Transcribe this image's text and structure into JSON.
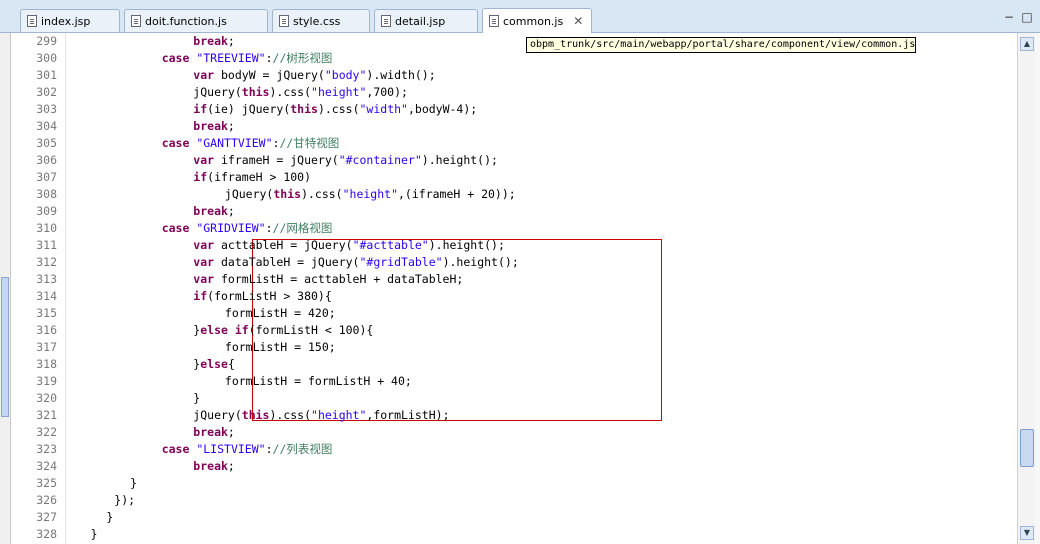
{
  "tabs": [
    {
      "label": "index.jsp",
      "active": false
    },
    {
      "label": "doit.function.js",
      "active": false
    },
    {
      "label": "style.css",
      "active": false
    },
    {
      "label": "detail.jsp",
      "active": false
    },
    {
      "label": "common.js",
      "active": true
    }
  ],
  "window_controls": {
    "minimize": "−",
    "maximize": "□"
  },
  "tooltip": "obpm_trunk/src/main/webapp/portal/share/component/view/common.js",
  "lines": [
    {
      "num": "299",
      "indent": 12,
      "tokens": [
        {
          "t": "kw",
          "v": "break"
        },
        {
          "t": "tx",
          "v": ";"
        }
      ]
    },
    {
      "num": "300",
      "indent": 8,
      "tokens": [
        {
          "t": "kw",
          "v": "case"
        },
        {
          "t": "tx",
          "v": " "
        },
        {
          "t": "str",
          "v": "\"TREEVIEW\""
        },
        {
          "t": "tx",
          "v": ":"
        },
        {
          "t": "cmt",
          "v": "//树形视图"
        }
      ]
    },
    {
      "num": "301",
      "indent": 12,
      "tokens": [
        {
          "t": "kw",
          "v": "var"
        },
        {
          "t": "tx",
          "v": " bodyW = jQuery("
        },
        {
          "t": "str",
          "v": "\"body\""
        },
        {
          "t": "tx",
          "v": ").width();"
        }
      ]
    },
    {
      "num": "302",
      "indent": 12,
      "tokens": [
        {
          "t": "tx",
          "v": "jQuery("
        },
        {
          "t": "kw",
          "v": "this"
        },
        {
          "t": "tx",
          "v": ").css("
        },
        {
          "t": "str",
          "v": "\"height\""
        },
        {
          "t": "tx",
          "v": ",700);"
        }
      ]
    },
    {
      "num": "303",
      "indent": 12,
      "tokens": [
        {
          "t": "kw",
          "v": "if"
        },
        {
          "t": "tx",
          "v": "(ie) jQuery("
        },
        {
          "t": "kw",
          "v": "this"
        },
        {
          "t": "tx",
          "v": ").css("
        },
        {
          "t": "str",
          "v": "\"width\""
        },
        {
          "t": "tx",
          "v": ",bodyW-4);"
        }
      ]
    },
    {
      "num": "304",
      "indent": 12,
      "tokens": [
        {
          "t": "kw",
          "v": "break"
        },
        {
          "t": "tx",
          "v": ";"
        }
      ]
    },
    {
      "num": "305",
      "indent": 8,
      "tokens": [
        {
          "t": "kw",
          "v": "case"
        },
        {
          "t": "tx",
          "v": " "
        },
        {
          "t": "str",
          "v": "\"GANTTVIEW\""
        },
        {
          "t": "tx",
          "v": ":"
        },
        {
          "t": "cmt",
          "v": "//甘特视图"
        }
      ]
    },
    {
      "num": "306",
      "indent": 12,
      "tokens": [
        {
          "t": "kw",
          "v": "var"
        },
        {
          "t": "tx",
          "v": " iframeH = jQuery("
        },
        {
          "t": "str",
          "v": "\"#container\""
        },
        {
          "t": "tx",
          "v": ").height();"
        }
      ]
    },
    {
      "num": "307",
      "indent": 12,
      "tokens": [
        {
          "t": "kw",
          "v": "if"
        },
        {
          "t": "tx",
          "v": "(iframeH > 100)"
        }
      ]
    },
    {
      "num": "308",
      "indent": 16,
      "tokens": [
        {
          "t": "tx",
          "v": "jQuery("
        },
        {
          "t": "kw",
          "v": "this"
        },
        {
          "t": "tx",
          "v": ").css("
        },
        {
          "t": "str",
          "v": "\"height\""
        },
        {
          "t": "tx",
          "v": ",(iframeH + 20));"
        }
      ]
    },
    {
      "num": "309",
      "indent": 12,
      "tokens": [
        {
          "t": "kw",
          "v": "break"
        },
        {
          "t": "tx",
          "v": ";"
        }
      ]
    },
    {
      "num": "310",
      "indent": 8,
      "tokens": [
        {
          "t": "kw",
          "v": "case"
        },
        {
          "t": "tx",
          "v": " "
        },
        {
          "t": "str",
          "v": "\"GRIDVIEW\""
        },
        {
          "t": "tx",
          "v": ":"
        },
        {
          "t": "cmt",
          "v": "//网格视图"
        }
      ]
    },
    {
      "num": "311",
      "indent": 12,
      "tokens": [
        {
          "t": "kw",
          "v": "var"
        },
        {
          "t": "tx",
          "v": " acttableH = jQuery("
        },
        {
          "t": "str",
          "v": "\"#acttable\""
        },
        {
          "t": "tx",
          "v": ").height();"
        }
      ]
    },
    {
      "num": "312",
      "indent": 12,
      "tokens": [
        {
          "t": "kw",
          "v": "var"
        },
        {
          "t": "tx",
          "v": " dataTableH = jQuery("
        },
        {
          "t": "str",
          "v": "\"#gridTable\""
        },
        {
          "t": "tx",
          "v": ").height();"
        }
      ]
    },
    {
      "num": "313",
      "indent": 12,
      "tokens": [
        {
          "t": "kw",
          "v": "var"
        },
        {
          "t": "tx",
          "v": " formListH = acttableH + dataTableH;"
        }
      ]
    },
    {
      "num": "314",
      "indent": 12,
      "tokens": [
        {
          "t": "kw",
          "v": "if"
        },
        {
          "t": "tx",
          "v": "(formListH > 380){"
        }
      ]
    },
    {
      "num": "315",
      "indent": 16,
      "tokens": [
        {
          "t": "tx",
          "v": "formListH = 420;"
        }
      ]
    },
    {
      "num": "316",
      "indent": 12,
      "tokens": [
        {
          "t": "tx",
          "v": "}"
        },
        {
          "t": "kw",
          "v": "else if"
        },
        {
          "t": "tx",
          "v": "(formListH < 100){"
        }
      ]
    },
    {
      "num": "317",
      "indent": 16,
      "tokens": [
        {
          "t": "tx",
          "v": "formListH = 150;"
        }
      ]
    },
    {
      "num": "318",
      "indent": 12,
      "tokens": [
        {
          "t": "tx",
          "v": "}"
        },
        {
          "t": "kw",
          "v": "else"
        },
        {
          "t": "tx",
          "v": "{"
        }
      ]
    },
    {
      "num": "319",
      "indent": 16,
      "tokens": [
        {
          "t": "tx",
          "v": "formListH = formListH + 40;"
        }
      ]
    },
    {
      "num": "320",
      "indent": 12,
      "tokens": [
        {
          "t": "tx",
          "v": "}"
        }
      ]
    },
    {
      "num": "321",
      "indent": 12,
      "tokens": [
        {
          "t": "tx",
          "v": "jQuery("
        },
        {
          "t": "kw",
          "v": "this"
        },
        {
          "t": "tx",
          "v": ").css("
        },
        {
          "t": "str",
          "v": "\"height\""
        },
        {
          "t": "tx",
          "v": ",formListH);"
        }
      ]
    },
    {
      "num": "322",
      "indent": 12,
      "tokens": [
        {
          "t": "kw",
          "v": "break"
        },
        {
          "t": "tx",
          "v": ";"
        }
      ]
    },
    {
      "num": "323",
      "indent": 8,
      "tokens": [
        {
          "t": "kw",
          "v": "case"
        },
        {
          "t": "tx",
          "v": " "
        },
        {
          "t": "str",
          "v": "\"LISTVIEW\""
        },
        {
          "t": "tx",
          "v": ":"
        },
        {
          "t": "cmt",
          "v": "//列表视图"
        }
      ]
    },
    {
      "num": "324",
      "indent": 12,
      "tokens": [
        {
          "t": "kw",
          "v": "break"
        },
        {
          "t": "tx",
          "v": ";"
        }
      ]
    },
    {
      "num": "325",
      "indent": 4,
      "tokens": [
        {
          "t": "tx",
          "v": "}"
        }
      ]
    },
    {
      "num": "326",
      "indent": 2,
      "tokens": [
        {
          "t": "tx",
          "v": "});"
        }
      ]
    },
    {
      "num": "327",
      "indent": 1,
      "tokens": [
        {
          "t": "tx",
          "v": "}"
        }
      ]
    },
    {
      "num": "328",
      "indent": -1,
      "tokens": [
        {
          "t": "tx",
          "v": "}"
        }
      ]
    }
  ],
  "colors": {
    "keyword": "#7f0055",
    "string": "#2a00ff",
    "comment": "#3f7f5f",
    "highlight_box": "#cc0000",
    "tooltip_bg": "#ffffe1"
  },
  "scroll_arrows": {
    "up": "▲",
    "down": "▼"
  }
}
